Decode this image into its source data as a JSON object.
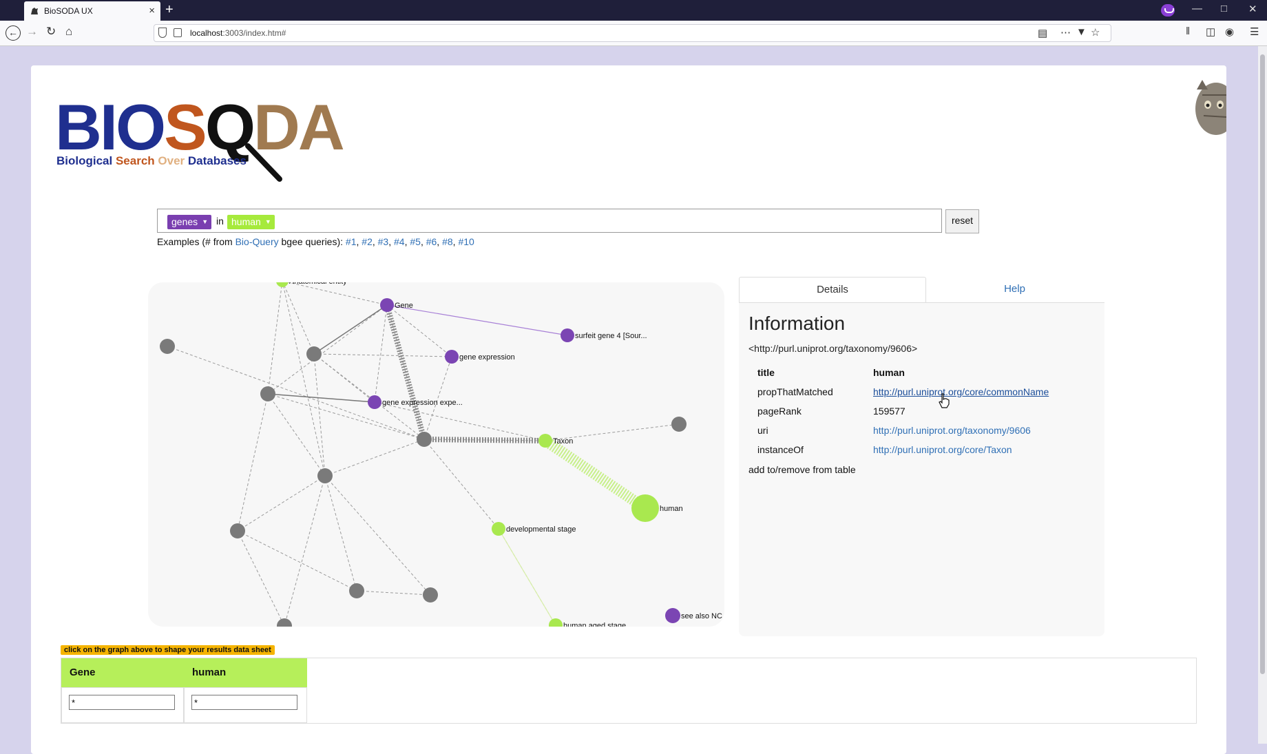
{
  "browser": {
    "tab_title": "BioSODA UX",
    "url_host": "localhost",
    "url_rest": ":3003/index.htm#",
    "new_tab_symbol": "+",
    "close_tab_symbol": "×"
  },
  "logo": {
    "letters": [
      {
        "char": "B",
        "color": "#1f2f8f"
      },
      {
        "char": "I",
        "color": "#1f2f8f"
      },
      {
        "char": "O",
        "color": "#1f2f8f"
      },
      {
        "char": "S",
        "color": "#c0561e"
      },
      {
        "char": "Q",
        "color": "#111111"
      },
      {
        "char": "D",
        "color": "#a07a50"
      },
      {
        "char": "A",
        "color": "#a07a50"
      }
    ],
    "subtitle": [
      {
        "word": "Biological",
        "color": "#1f2f8f"
      },
      {
        "word": "Search",
        "color": "#c0561e"
      },
      {
        "word": "Over",
        "color": "#e0b080"
      },
      {
        "word": "Databases",
        "color": "#1f2f8f"
      }
    ]
  },
  "search": {
    "chips": [
      {
        "label": "genes",
        "color": "#7a3fb0"
      },
      {
        "label": "human",
        "color": "#a6ea3c"
      }
    ],
    "connector": "in",
    "reset_label": "reset"
  },
  "examples": {
    "prefix": "Examples (# from ",
    "source_link": "Bio-Query",
    "middle": " bgee queries): ",
    "links": [
      "#1",
      "#2",
      "#3",
      "#4",
      "#5",
      "#6",
      "#8",
      "#10"
    ]
  },
  "graph": {
    "node_labels": {
      "anatomical_entity": "Anatomical entity",
      "gene": "Gene",
      "surfeit": "surfeit gene 4 [Sour...",
      "gene_expression": "gene expression",
      "gene_expression_exp": "gene expression expe...",
      "taxon": "Taxon",
      "human": "human",
      "developmental_stage": "developmental stage",
      "human_aged_stage": "human aged stage",
      "see_also": "see also NC"
    },
    "colors": {
      "purple": "#7b45b3",
      "green": "#a9e84f",
      "gray": "#7a7a7a"
    }
  },
  "details": {
    "tabs": [
      "Details",
      "Help"
    ],
    "heading": "Information",
    "uri": "<http://purl.uniprot.org/taxonomy/9606>",
    "rows": [
      {
        "key": "title",
        "value": "human"
      },
      {
        "key": "propThatMatched",
        "value": "http://purl.uniprot.org/core/commonName"
      },
      {
        "key": "pageRank",
        "value": "159577"
      },
      {
        "key": "uri",
        "value": "http://purl.uniprot.org/taxonomy/9606"
      },
      {
        "key": "instanceOf",
        "value": "http://purl.uniprot.org/core/Taxon"
      }
    ],
    "add_remove": "add to/remove from table"
  },
  "results": {
    "hint": "click on the graph above to shape your results data sheet",
    "columns": [
      {
        "header": "Gene",
        "filter": "*"
      },
      {
        "header": "human",
        "filter": "*"
      }
    ]
  }
}
